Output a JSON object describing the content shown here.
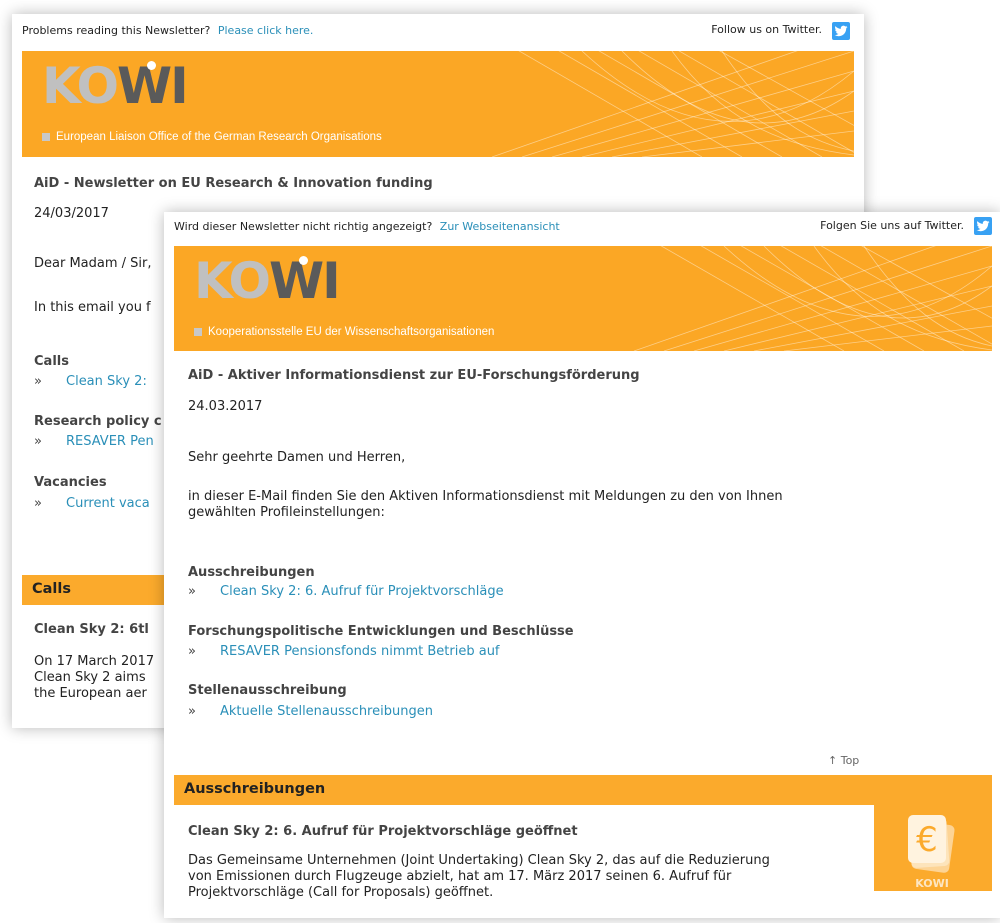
{
  "en": {
    "problem_text": "Problems reading this Newsletter?",
    "problem_link": "Please click here.",
    "follow": "Follow us on Twitter.",
    "logo_ko": "KO",
    "logo_wi": "WI",
    "banner_sub": "European Liaison Office of the German Research Organisations",
    "title": "AiD - Newsletter on EU Research & Innovation funding",
    "date": "24/03/2017",
    "greeting": "Dear Madam / Sir,",
    "intro": "In this email you f",
    "calls_heading": "Calls",
    "calls_item": "Clean Sky 2:",
    "policy_heading": "Research policy c",
    "policy_item": "RESAVER Pen",
    "vacancies_heading": "Vacancies",
    "vacancies_item": "Current vaca",
    "section_bar": "Calls",
    "article_title": "Clean Sky 2: 6tl",
    "article_lines": [
      "On 17 March 2017",
      "Clean Sky 2 aims",
      "the European aer"
    ]
  },
  "de": {
    "problem_text": "Wird dieser Newsletter nicht richtig angezeigt?",
    "problem_link": "Zur Webseitenansicht",
    "follow": "Folgen Sie uns auf Twitter.",
    "logo_ko": "KO",
    "logo_wi": "WI",
    "banner_sub": "Kooperationsstelle EU der Wissenschaftsorganisationen",
    "title": "AiD - Aktiver Informationsdienst zur EU-Forschungsförderung",
    "date": "24.03.2017",
    "greeting": "Sehr geehrte Damen und Herren,",
    "intro_1": "in dieser E-Mail finden Sie den Aktiven Informationsdienst mit Meldungen zu den von Ihnen",
    "intro_2": "gewählten Profileinstellungen:",
    "calls_heading": "Ausschreibungen",
    "calls_item": "Clean Sky 2: 6. Aufruf für Projektvorschläge",
    "policy_heading": "Forschungspolitische Entwicklungen und Beschlüsse",
    "policy_item": "RESAVER Pensionsfonds nimmt Betrieb auf",
    "vacancies_heading": "Stellenausschreibung",
    "vacancies_item": "Aktuelle Stellenausschreibungen",
    "top_link": "↑ Top",
    "section_bar": "Ausschreibungen",
    "article_title": "Clean Sky 2: 6. Aufruf für Projektvorschläge geöffnet",
    "article_lines": [
      "Das Gemeinsame Unternehmen (Joint Undertaking) Clean Sky 2, das auf die Reduzierung",
      "von Emissionen durch Flugzeuge abzielt, hat am 17. März 2017 seinen 6. Aufruf für",
      "Projektvorschläge (Call for Proposals) geöffnet."
    ],
    "euro_symbol": "€",
    "euro_logo": "KOWI"
  },
  "bullet": "»",
  "colors": {
    "accent": "#fbaa2c",
    "link": "#2a8fb8",
    "twitter": "#38a1f3"
  },
  "icons": {
    "twitter": "twitter-icon",
    "euro": "euro-funding-icon"
  }
}
